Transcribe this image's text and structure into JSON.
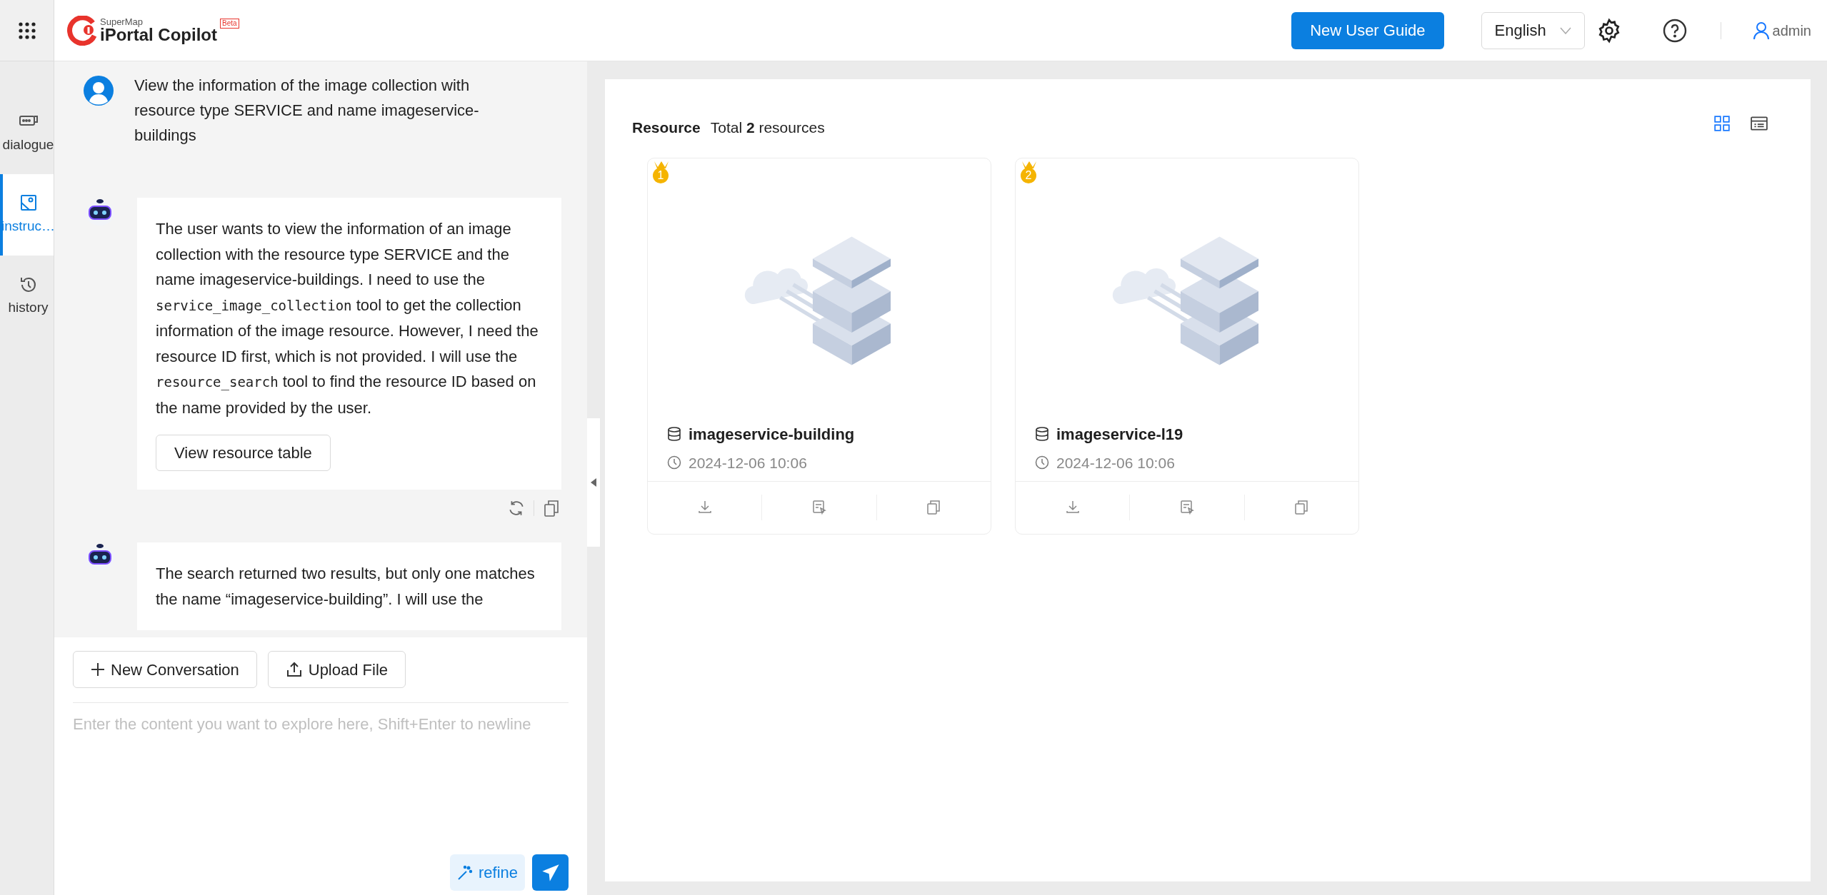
{
  "header": {
    "logo_subtitle": "SuperMap",
    "logo_title": "iPortal Copilot",
    "badge": "Beta",
    "guide_button": "New User Guide",
    "language": "English",
    "user": "admin"
  },
  "nav": [
    {
      "label": "dialogue",
      "selected": false
    },
    {
      "label": "instruc…",
      "selected": true
    },
    {
      "label": "history",
      "selected": false
    }
  ],
  "messages": [
    {
      "kind": "user",
      "segments": [
        {
          "kind": "text",
          "text": "View the information of the image collection with resource type SERVICE and name imageservice-buildings"
        }
      ]
    },
    {
      "kind": "assistant",
      "segments": [
        {
          "kind": "text",
          "text": "The user wants to view the information of an image collection with the resource type SERVICE and the name imageservice-buildings. I need to use the "
        },
        {
          "kind": "code",
          "text": "service_image_collection"
        },
        {
          "kind": "text",
          "text": " tool to get the collection information of the image resource. However, I need the resource ID first, which is not provided. I will use the "
        },
        {
          "kind": "code",
          "text": "resource_search"
        },
        {
          "kind": "text",
          "text": " tool to find the resource ID based on the name provided by the user."
        }
      ],
      "button": "View resource table",
      "actions": true
    },
    {
      "kind": "assistant",
      "segments": [
        {
          "kind": "text",
          "text": "The search returned two results, but only one matches the name “imageservice-building”. I will use the"
        }
      ],
      "actions": false
    }
  ],
  "composer": {
    "new_button": "New Conversation",
    "upload_button": "Upload File",
    "placeholder": "Enter the content you want to explore here, Shift+Enter to newline",
    "refine_button": "refine"
  },
  "resources": {
    "title": "Resource",
    "summary": "Total **2** resources",
    "views": [
      {
        "kind": "grid",
        "selected": true
      },
      {
        "kind": "list",
        "selected": false
      }
    ],
    "cards": [
      {
        "rank": "1",
        "name": "imageservice-building",
        "date": "2024-12-06 10:06"
      },
      {
        "rank": "2",
        "name": "imageservice-l19",
        "date": "2024-12-06 10:06"
      }
    ]
  }
}
